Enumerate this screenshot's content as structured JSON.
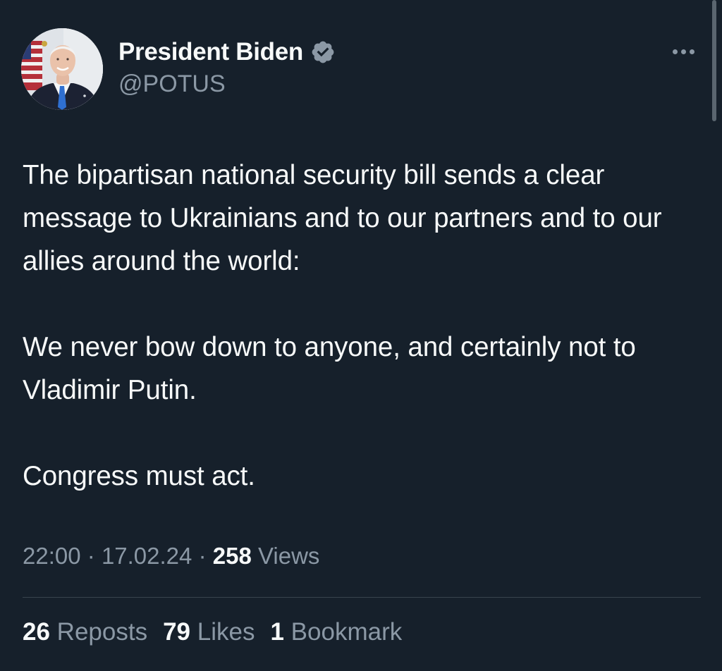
{
  "author": {
    "display_name": "President Biden",
    "handle": "@POTUS",
    "verified": true,
    "avatar": "avatar-photo"
  },
  "tweet": {
    "paragraphs": [
      "The bipartisan national security bill sends a clear message to Ukrainians and to our partners and to our allies around the world:",
      "We never bow down to anyone, and certainly not to Vladimir Putin.",
      "Congress must act."
    ],
    "time": "22:00",
    "date": "17.02.24",
    "views_count": "258",
    "views_label": "Views",
    "separator": "·"
  },
  "stats": {
    "reposts_count": "26",
    "reposts_label": "Reposts",
    "likes_count": "79",
    "likes_label": "Likes",
    "bookmarks_count": "1",
    "bookmarks_label": "Bookmark"
  },
  "icons": {
    "verified": "verified-badge-icon",
    "more": "more-options-icon"
  },
  "colors": {
    "background": "#16202b",
    "text_primary": "#f7f9f9",
    "text_secondary": "#8b98a5",
    "divider": "#38444d",
    "badge": "#8b98a5"
  }
}
